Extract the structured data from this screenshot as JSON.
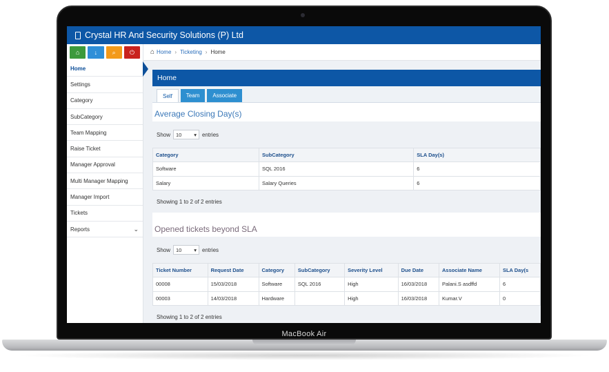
{
  "app": {
    "title": "Crystal HR And Security Solutions (P) Ltd",
    "brand_color": "#0d57a6"
  },
  "device": {
    "label": "MacBook Air"
  },
  "quick_buttons": [
    {
      "icon": "home-icon",
      "color": "#3c9a3c",
      "glyph": "⌂"
    },
    {
      "icon": "download-icon",
      "color": "#2f8fd8",
      "glyph": "↓"
    },
    {
      "icon": "search-icon",
      "color": "#f39a1a",
      "glyph": "⌕"
    },
    {
      "icon": "power-icon",
      "color": "#c9221d",
      "glyph": "⏻"
    }
  ],
  "sidebar": {
    "items": [
      {
        "label": "Home",
        "active": true
      },
      {
        "label": "Settings"
      },
      {
        "label": "Category"
      },
      {
        "label": "SubCategory"
      },
      {
        "label": "Team Mapping"
      },
      {
        "label": "Raise Ticket"
      },
      {
        "label": "Manager Approval"
      },
      {
        "label": "Multi Manager Mapping"
      },
      {
        "label": "Manager Import"
      },
      {
        "label": "Tickets"
      },
      {
        "label": "Reports",
        "chevron": "⌄"
      }
    ]
  },
  "breadcrumb": {
    "home": "Home",
    "section": "Ticketing",
    "current": "Home"
  },
  "panel": {
    "title": "Home"
  },
  "tabs": [
    "Self",
    "Team",
    "Associate"
  ],
  "closing": {
    "title": "Average Closing Day(s)",
    "show_label": "Show",
    "page_size": "10",
    "entries_label": "entries",
    "columns": [
      "Category",
      "SubCategory",
      "SLA Day(s)"
    ],
    "rows": [
      [
        "Software",
        "SQL 2016",
        "6"
      ],
      [
        "Salary",
        "Salary Queries",
        "6"
      ]
    ],
    "info": "Showing 1 to 2 of 2 entries"
  },
  "sla": {
    "title": "Opened tickets beyond SLA",
    "show_label": "Show",
    "page_size": "10",
    "entries_label": "entries",
    "columns": [
      "Ticket Number",
      "Request Date",
      "Category",
      "SubCategory",
      "Severity Level",
      "Due Date",
      "Associate Name",
      "SLA Day(s"
    ],
    "rows": [
      [
        "00008",
        "15/03/2018",
        "Software",
        "SQL 2016",
        "High",
        "16/03/2018",
        "Palani.S asdffd",
        "6"
      ],
      [
        "00003",
        "14/03/2018",
        "Hardware",
        "",
        "High",
        "16/03/2018",
        "Kumar.V",
        "0"
      ]
    ],
    "info": "Showing 1 to 2 of 2 entries"
  }
}
